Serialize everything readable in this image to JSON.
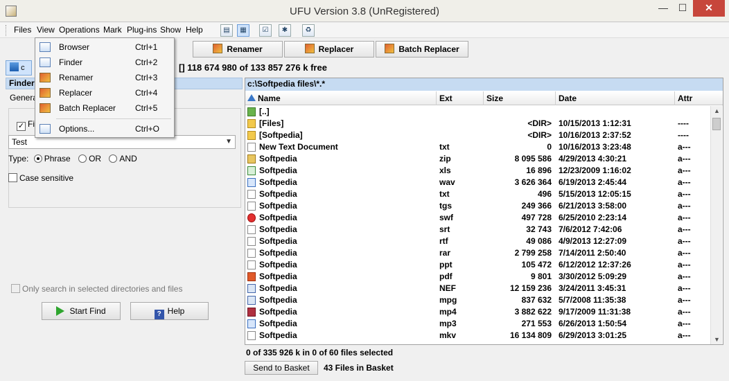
{
  "window": {
    "title": "UFU Version 3.8 (UnRegistered)",
    "min": "—",
    "max": "☐",
    "close": "✕"
  },
  "menubar": {
    "items": [
      "Files",
      "View",
      "Operations",
      "Mark",
      "Plug-ins",
      "Show",
      "Help"
    ]
  },
  "toolbar_icons": [
    "browser-view-icon",
    "finder-view-icon",
    "options-icon",
    "info-icon",
    "basket-icon"
  ],
  "tabs": {
    "renamer": "Renamer",
    "replacer": "Replacer",
    "batch_replacer": "Batch Replacer"
  },
  "drive": {
    "label": "c",
    "free_space": "[]  118 674 980 of 133 857 276 k free"
  },
  "finder": {
    "header": "Finder",
    "general_tab": "Genera",
    "find_label": "Fin",
    "search_value": "Test",
    "type_label": "Type:",
    "type_options": [
      "Phrase",
      "OR",
      "AND"
    ],
    "case_sensitive": "Case sensitive",
    "only_selected": "Only search in selected directories and files",
    "start_button": "Start Find",
    "help_button": "Help"
  },
  "file_panel": {
    "path": "c:\\Softpedia files\\*.*",
    "columns": [
      "Name",
      "Ext",
      "Size",
      "Date",
      "Attr"
    ],
    "rows": [
      {
        "icon": "up",
        "name": "[..]",
        "ext": "",
        "size": "",
        "date": "",
        "attr": ""
      },
      {
        "icon": "folder",
        "name": "[Files]",
        "ext": "",
        "size": "<DIR>",
        "date": "10/15/2013 1:12:31",
        "attr": "----"
      },
      {
        "icon": "folder",
        "name": "[Softpedia]",
        "ext": "",
        "size": "<DIR>",
        "date": "10/16/2013 2:37:52",
        "attr": "----"
      },
      {
        "icon": "doc",
        "name": "New Text Document",
        "ext": "txt",
        "size": "0",
        "date": "10/16/2013 3:23:48",
        "attr": "a---"
      },
      {
        "icon": "zip",
        "name": "Softpedia",
        "ext": "zip",
        "size": "8 095 586",
        "date": "4/29/2013 4:30:21",
        "attr": "a---"
      },
      {
        "icon": "xls",
        "name": "Softpedia",
        "ext": "xls",
        "size": "16 896",
        "date": "12/23/2009 1:16:02",
        "attr": "a---"
      },
      {
        "icon": "audio",
        "name": "Softpedia",
        "ext": "wav",
        "size": "3 626 364",
        "date": "6/19/2013 2:45:44",
        "attr": "a---"
      },
      {
        "icon": "doc",
        "name": "Softpedia",
        "ext": "txt",
        "size": "496",
        "date": "5/15/2013 12:05:15",
        "attr": "a---"
      },
      {
        "icon": "doc",
        "name": "Softpedia",
        "ext": "tgs",
        "size": "249 366",
        "date": "6/21/2013 3:58:00",
        "attr": "a---"
      },
      {
        "icon": "swf",
        "name": "Softpedia",
        "ext": "swf",
        "size": "497 728",
        "date": "6/25/2010 2:23:14",
        "attr": "a---"
      },
      {
        "icon": "doc",
        "name": "Softpedia",
        "ext": "srt",
        "size": "32 743",
        "date": "7/6/2012 7:42:06",
        "attr": "a---"
      },
      {
        "icon": "doc",
        "name": "Softpedia",
        "ext": "rtf",
        "size": "49 086",
        "date": "4/9/2013 12:27:09",
        "attr": "a---"
      },
      {
        "icon": "doc",
        "name": "Softpedia",
        "ext": "rar",
        "size": "2 799 258",
        "date": "7/14/2011 2:50:40",
        "attr": "a---"
      },
      {
        "icon": "doc",
        "name": "Softpedia",
        "ext": "ppt",
        "size": "105 472",
        "date": "6/12/2012 12:37:26",
        "attr": "a---"
      },
      {
        "icon": "pdf",
        "name": "Softpedia",
        "ext": "pdf",
        "size": "9 801",
        "date": "3/30/2012 5:09:29",
        "attr": "a---"
      },
      {
        "icon": "img",
        "name": "Softpedia",
        "ext": "NEF",
        "size": "12 159 236",
        "date": "3/24/2011 3:45:31",
        "attr": "a---"
      },
      {
        "icon": "img",
        "name": "Softpedia",
        "ext": "mpg",
        "size": "837 632",
        "date": "5/7/2008 11:35:38",
        "attr": "a---"
      },
      {
        "icon": "mp4",
        "name": "Softpedia",
        "ext": "mp4",
        "size": "3 882 622",
        "date": "9/17/2009 11:31:38",
        "attr": "a---"
      },
      {
        "icon": "audio",
        "name": "Softpedia",
        "ext": "mp3",
        "size": "271 553",
        "date": "6/26/2013 1:50:54",
        "attr": "a---"
      },
      {
        "icon": "doc",
        "name": "Softpedia",
        "ext": "mkv",
        "size": "16 134 809",
        "date": "6/29/2013 3:01:25",
        "attr": "a---"
      }
    ]
  },
  "status": {
    "selection": "0 of 335 926 k in 0 of 60 files selected",
    "send_button": "Send to Basket",
    "basket_count": "43 Files in Basket"
  },
  "view_menu": {
    "items": [
      {
        "label": "Browser",
        "key": "Ctrl+1"
      },
      {
        "label": "Finder",
        "key": "Ctrl+2"
      },
      {
        "label": "Renamer",
        "key": "Ctrl+3"
      },
      {
        "label": "Replacer",
        "key": "Ctrl+4"
      },
      {
        "label": "Batch Replacer",
        "key": "Ctrl+5"
      },
      {
        "label": "Options...",
        "key": "Ctrl+O"
      }
    ]
  }
}
